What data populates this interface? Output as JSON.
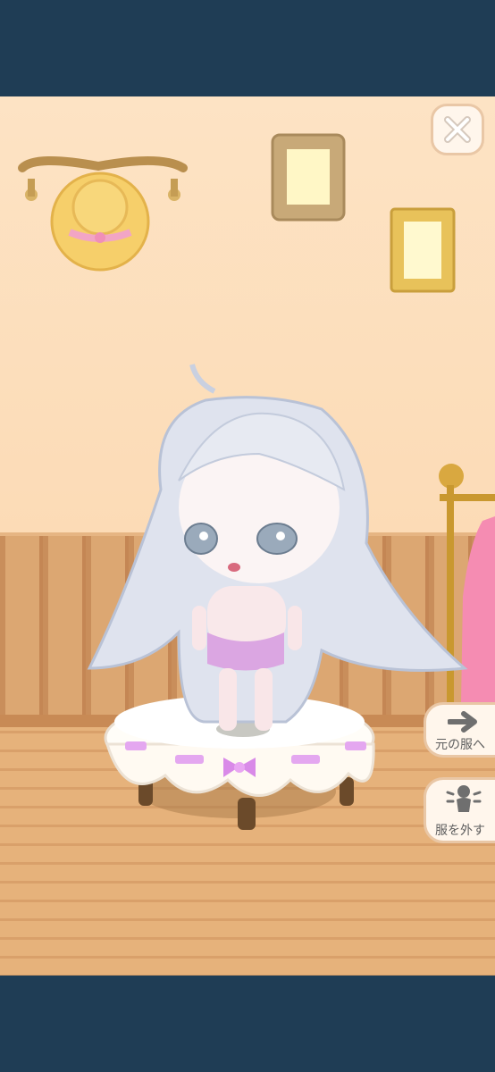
{
  "buttons": {
    "close_icon": "close-icon",
    "revert_label": "元の服へ",
    "revert_icon": "arrow-right-icon",
    "remove_label": "服を外す",
    "remove_icon": "undress-icon"
  },
  "colors": {
    "nav_bar": "#1f3d55",
    "wall": "#fde3c4",
    "button_bg": "#fff6ec",
    "accent_pink": "#e88dd8"
  }
}
